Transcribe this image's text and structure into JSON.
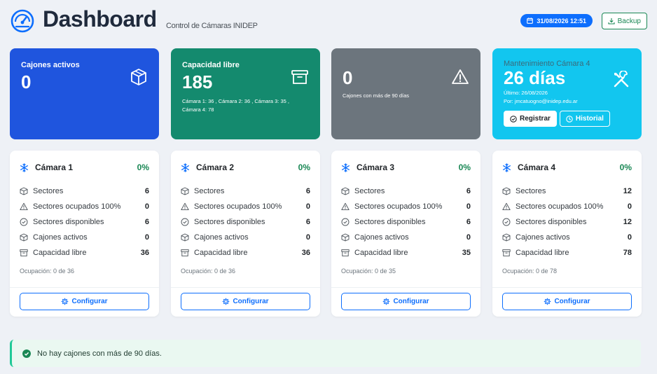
{
  "header": {
    "title": "Dashboard",
    "subtitle": "Control de Cámaras INIDEP",
    "datetime": "31/08/2026 12:51",
    "backup_label": "Backup",
    "logo_icon": "speedometer-icon"
  },
  "stats": [
    {
      "label": "Cajones activos",
      "value": "0",
      "sub": "",
      "icon": "box-icon",
      "color": "#1f55de"
    },
    {
      "label": "Capacidad libre",
      "value": "185",
      "sub": "Cámara 1: 36 , Cámara 2: 36 , Cámara 3: 35 , Cámara 4: 78",
      "icon": "archive-icon",
      "color": "#148a6e"
    },
    {
      "label": "",
      "value": "0",
      "sub": "Cajones con más de 90 días",
      "icon": "warning-icon",
      "color": "#6c757d"
    },
    {
      "label": "Mantenimiento Cámara 4",
      "value": "26 días",
      "sub1": "Último: 26/08/2026",
      "sub2": "Por: jmcatuogno@inidep.edu.ar",
      "icon": "tools-icon",
      "color": "#12c6ef",
      "register_label": "Registrar",
      "history_label": "Historial"
    }
  ],
  "row_labels": {
    "sectores": "Sectores",
    "ocupados": "Sectores ocupados 100%",
    "disponibles": "Sectores disponibles",
    "cajones": "Cajones activos",
    "capacidad": "Capacidad libre"
  },
  "cameras": [
    {
      "title": "Cámara 1",
      "pct": "0%",
      "sectores": "6",
      "ocupados": "0",
      "disponibles": "6",
      "cajones": "0",
      "capacidad": "36",
      "occupancy": "Ocupación: 0 de 36",
      "config_label": "Configurar"
    },
    {
      "title": "Cámara 2",
      "pct": "0%",
      "sectores": "6",
      "ocupados": "0",
      "disponibles": "6",
      "cajones": "0",
      "capacidad": "36",
      "occupancy": "Ocupación: 0 de 36",
      "config_label": "Configurar"
    },
    {
      "title": "Cámara 3",
      "pct": "0%",
      "sectores": "6",
      "ocupados": "0",
      "disponibles": "6",
      "cajones": "0",
      "capacidad": "35",
      "occupancy": "Ocupación: 0 de 35",
      "config_label": "Configurar"
    },
    {
      "title": "Cámara 4",
      "pct": "0%",
      "sectores": "12",
      "ocupados": "0",
      "disponibles": "12",
      "cajones": "0",
      "capacidad": "78",
      "occupancy": "Ocupación: 0 de 78",
      "config_label": "Configurar"
    }
  ],
  "alert": {
    "text": "No hay cajones con más de 90 días.",
    "icon": "check-circle-icon"
  },
  "colors": {
    "primary": "#0d6efd",
    "success": "#198754",
    "text": "#212529"
  }
}
